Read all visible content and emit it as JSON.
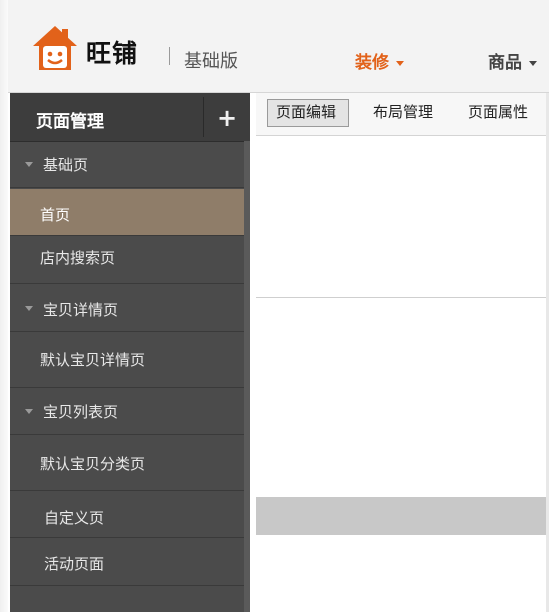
{
  "header": {
    "brand": "旺铺",
    "edition": "基础版",
    "nav": [
      {
        "label": "装修",
        "active": true,
        "color": "#e2621a"
      },
      {
        "label": "商品",
        "active": false
      }
    ]
  },
  "sidebar": {
    "title": "页面管理",
    "add_icon": "plus-icon",
    "groups": [
      {
        "label": "基础页",
        "items": [
          "首页",
          "店内搜索页"
        ]
      },
      {
        "label": "宝贝详情页",
        "items": [
          "默认宝贝详情页"
        ]
      },
      {
        "label": "宝贝列表页",
        "items": [
          "默认宝贝分类页"
        ]
      }
    ],
    "extra_items": [
      "自定义页",
      "活动页面"
    ],
    "selected": "首页"
  },
  "main": {
    "tabs": [
      "页面编辑",
      "布局管理",
      "页面属性"
    ],
    "active_tab": "页面编辑"
  },
  "colors": {
    "accent": "#e2621a",
    "sidebar_bg": "#4b4b4b",
    "active_row": "#8f7d69"
  }
}
